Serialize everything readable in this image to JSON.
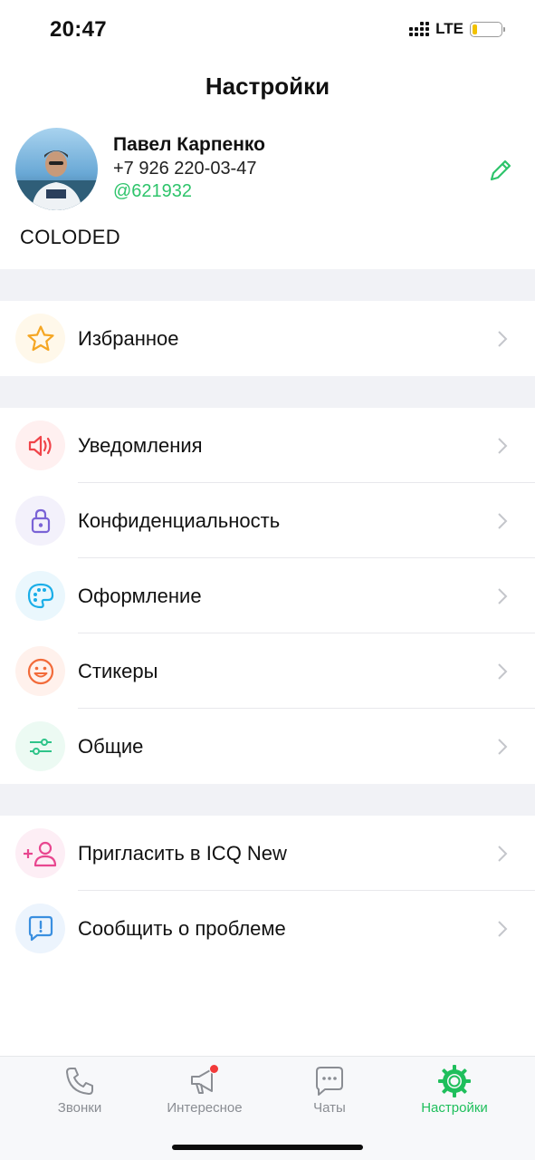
{
  "status_bar": {
    "time": "20:47",
    "network": "LTE",
    "battery_level": 0.15
  },
  "page": {
    "title": "Настройки"
  },
  "profile": {
    "name": "Павел Карпенко",
    "phone": "+7 926 220-03-47",
    "nick": "@621932",
    "status": "COLODED"
  },
  "groups": [
    {
      "items": [
        {
          "label": "Избранное",
          "icon": "star-icon",
          "color": "#f5a623",
          "bg": "#fff8ea"
        }
      ]
    },
    {
      "items": [
        {
          "label": "Уведомления",
          "icon": "speaker-icon",
          "color": "#f0444a",
          "bg": "#fff0f0"
        },
        {
          "label": "Конфиденциальность",
          "icon": "lock-icon",
          "color": "#7a63d6",
          "bg": "#f3f1fb"
        },
        {
          "label": "Оформление",
          "icon": "palette-icon",
          "color": "#1aaee8",
          "bg": "#eaf7fd"
        },
        {
          "label": "Стикеры",
          "icon": "smile-icon",
          "color": "#f26b3a",
          "bg": "#fff1ec"
        },
        {
          "label": "Общие",
          "icon": "sliders-icon",
          "color": "#2fc48a",
          "bg": "#ecfaf3"
        }
      ]
    },
    {
      "items": [
        {
          "label": "Пригласить в ICQ New",
          "icon": "add-user-icon",
          "color": "#e8468f",
          "bg": "#fdeef5"
        },
        {
          "label": "Сообщить о проблеме",
          "icon": "report-icon",
          "color": "#3a8fe0",
          "bg": "#ecf4fd"
        }
      ]
    }
  ],
  "tabs": [
    {
      "label": "Звонки",
      "icon": "phone-icon",
      "active": false
    },
    {
      "label": "Интересное",
      "icon": "megaphone-icon",
      "active": false,
      "badge": true
    },
    {
      "label": "Чаты",
      "icon": "chat-icon",
      "active": false
    },
    {
      "label": "Настройки",
      "icon": "settings-icon",
      "active": true
    }
  ],
  "colors": {
    "accent": "#1fbf5c",
    "nick": "#2ec46b",
    "separator": "#f1f2f6"
  }
}
